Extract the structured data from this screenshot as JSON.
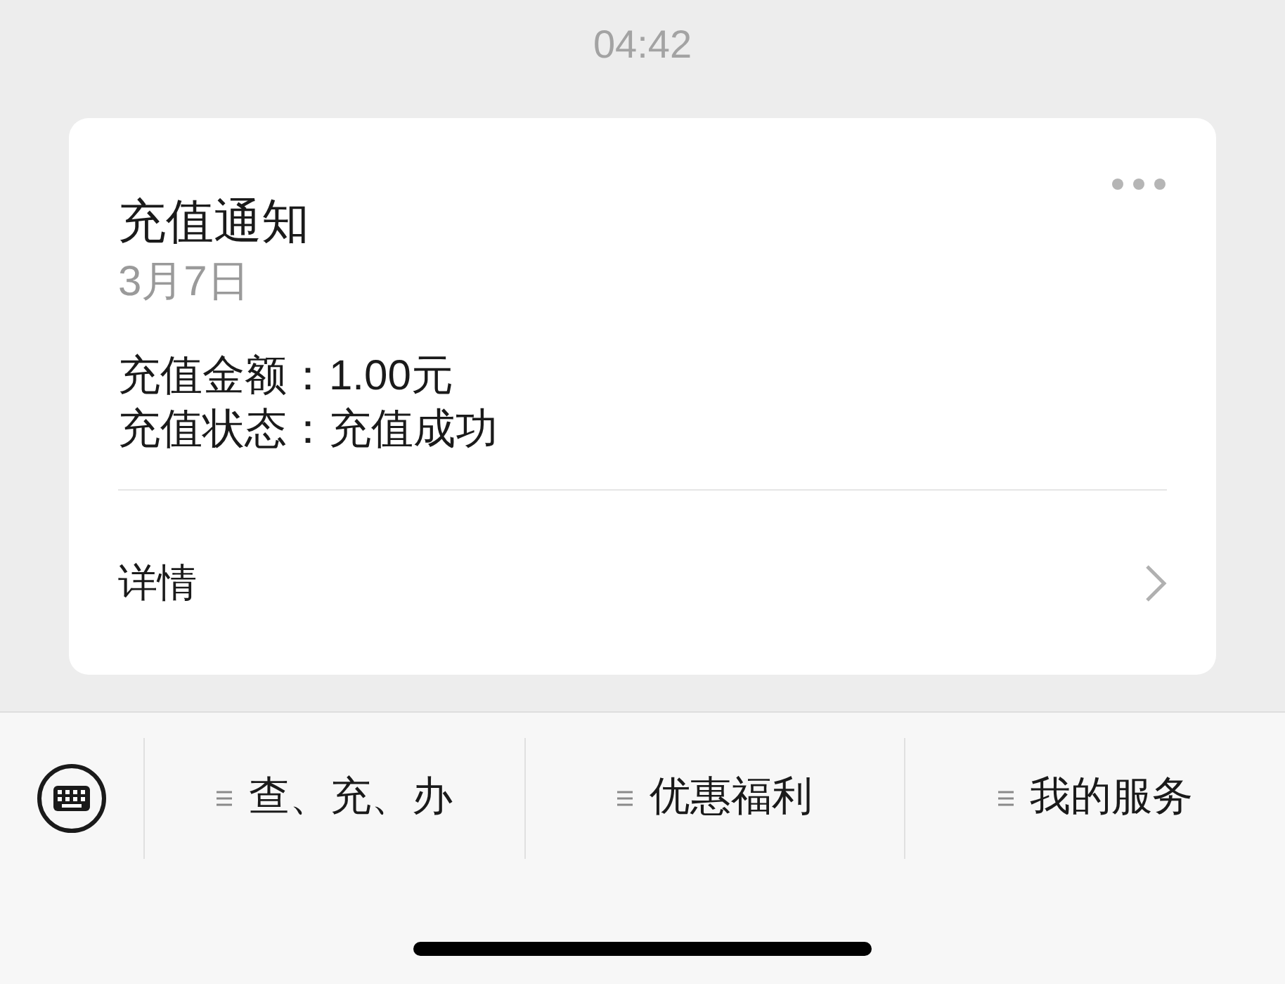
{
  "time": "04:42",
  "card": {
    "title": "充值通知",
    "date": "3月7日",
    "lines": [
      "充值金额：1.00元",
      "充值状态：充值成功"
    ],
    "link": "详情"
  },
  "menu": [
    {
      "label": "查、充、办"
    },
    {
      "label": "优惠福利"
    },
    {
      "label": "我的服务"
    }
  ]
}
